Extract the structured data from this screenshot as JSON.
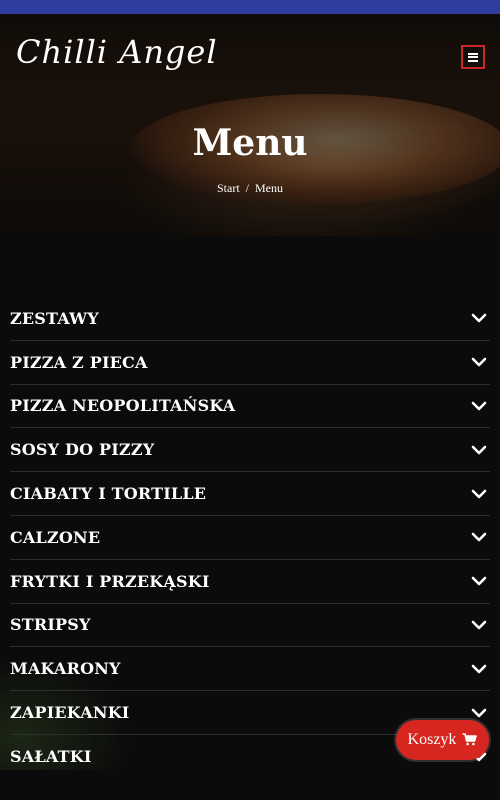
{
  "header": {
    "logo_text": "Chilli Angel",
    "menu_toggle_icon": "hamburger-icon"
  },
  "hero": {
    "title": "Menu",
    "breadcrumb": {
      "home": "Start",
      "separator": "/",
      "current": "Menu"
    }
  },
  "categories": [
    {
      "label": "ZESTAWY"
    },
    {
      "label": "PIZZA Z PIECA"
    },
    {
      "label": "PIZZA NEOPOLITAŃSKA"
    },
    {
      "label": "SOSY DO PIZZY"
    },
    {
      "label": "CIABATY I TORTILLE"
    },
    {
      "label": "CALZONE"
    },
    {
      "label": "FRYTKI I PRZEKĄSKI"
    },
    {
      "label": "STRIPSY"
    },
    {
      "label": "MAKARONY"
    },
    {
      "label": "ZAPIEKANKI"
    },
    {
      "label": "SAŁATKI"
    }
  ],
  "cart": {
    "label": "Koszyk",
    "icon": "cart-icon"
  },
  "colors": {
    "accent": "#d6261f",
    "top_bar": "#2f3e9e",
    "background": "#0b0b0b"
  }
}
